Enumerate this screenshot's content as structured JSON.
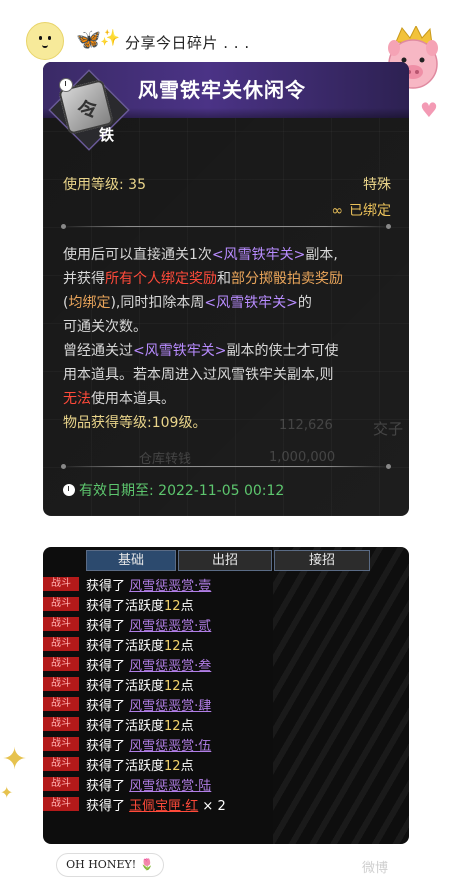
{
  "header": {
    "text": "分享今日碎片 . . .",
    "butterfly_icon": "🦋",
    "sparkle_icon": "✨"
  },
  "tooltip": {
    "title": "风雪铁牢关休闲令",
    "bind_char": "铁",
    "level_label": "使用等级: 35",
    "special": "特殊",
    "bound": "已绑定",
    "desc": {
      "p1a": "使用后可以直接通关1次",
      "p1b": "<风雪铁牢关>",
      "p1c": "副本,",
      "p2a": "并获得",
      "p2b": "所有个人绑定奖励",
      "p2c": "和",
      "p2d": "部分掷骰拍卖奖励",
      "p3a": "(",
      "p3b": "均绑定",
      "p3c": "),同时扣除本周",
      "p3d": "<风雪铁牢关>",
      "p3e": "的",
      "p4": "可通关次数。",
      "p5a": "曾经通关过",
      "p5b": "<风雪铁牢关>",
      "p5c": "副本的侠士才可使",
      "p6": "用本道具。若本周进入过风雪铁牢关副本,则",
      "p7a": "无法",
      "p7b": "使用本道具。",
      "p8": "物品获得等级:109级。"
    },
    "expire": "有效日期至: 2022-11-05 00:12",
    "bg_text": {
      "a": "112,626",
      "b": "交子",
      "c": "仓库转钱",
      "d": "1,000,000"
    }
  },
  "log": {
    "tabs": [
      "基础",
      "出招",
      "接招"
    ],
    "badge": "战斗",
    "rows": [
      {
        "prefix": "获得了 ",
        "item": "风雪惩恶赏·壹",
        "suffix": "",
        "kind": "item"
      },
      {
        "prefix": "获得了活跃度",
        "num": "12",
        "suffix": "点",
        "kind": "active"
      },
      {
        "prefix": "获得了 ",
        "item": "风雪惩恶赏·贰",
        "suffix": "",
        "kind": "item"
      },
      {
        "prefix": "获得了活跃度",
        "num": "12",
        "suffix": "点",
        "kind": "active"
      },
      {
        "prefix": "获得了 ",
        "item": "风雪惩恶赏·叁",
        "suffix": "",
        "kind": "item"
      },
      {
        "prefix": "获得了活跃度",
        "num": "12",
        "suffix": "点",
        "kind": "active"
      },
      {
        "prefix": "获得了 ",
        "item": "风雪惩恶赏·肆",
        "suffix": "",
        "kind": "item"
      },
      {
        "prefix": "获得了活跃度",
        "num": "12",
        "suffix": "点",
        "kind": "active"
      },
      {
        "prefix": "获得了 ",
        "item": "风雪惩恶赏·伍",
        "suffix": "",
        "kind": "item"
      },
      {
        "prefix": "获得了活跃度",
        "num": "12",
        "suffix": "点",
        "kind": "active"
      },
      {
        "prefix": "获得了 ",
        "item": "风雪惩恶赏·陆",
        "suffix": "",
        "kind": "item"
      },
      {
        "prefix": "获得了 ",
        "item": "玉佩宝匣·红",
        "suffix": " × 2",
        "kind": "red"
      }
    ]
  },
  "footer": {
    "honey": "OH HONEY!",
    "flower_icon": "🌷",
    "watermark": "微博"
  }
}
